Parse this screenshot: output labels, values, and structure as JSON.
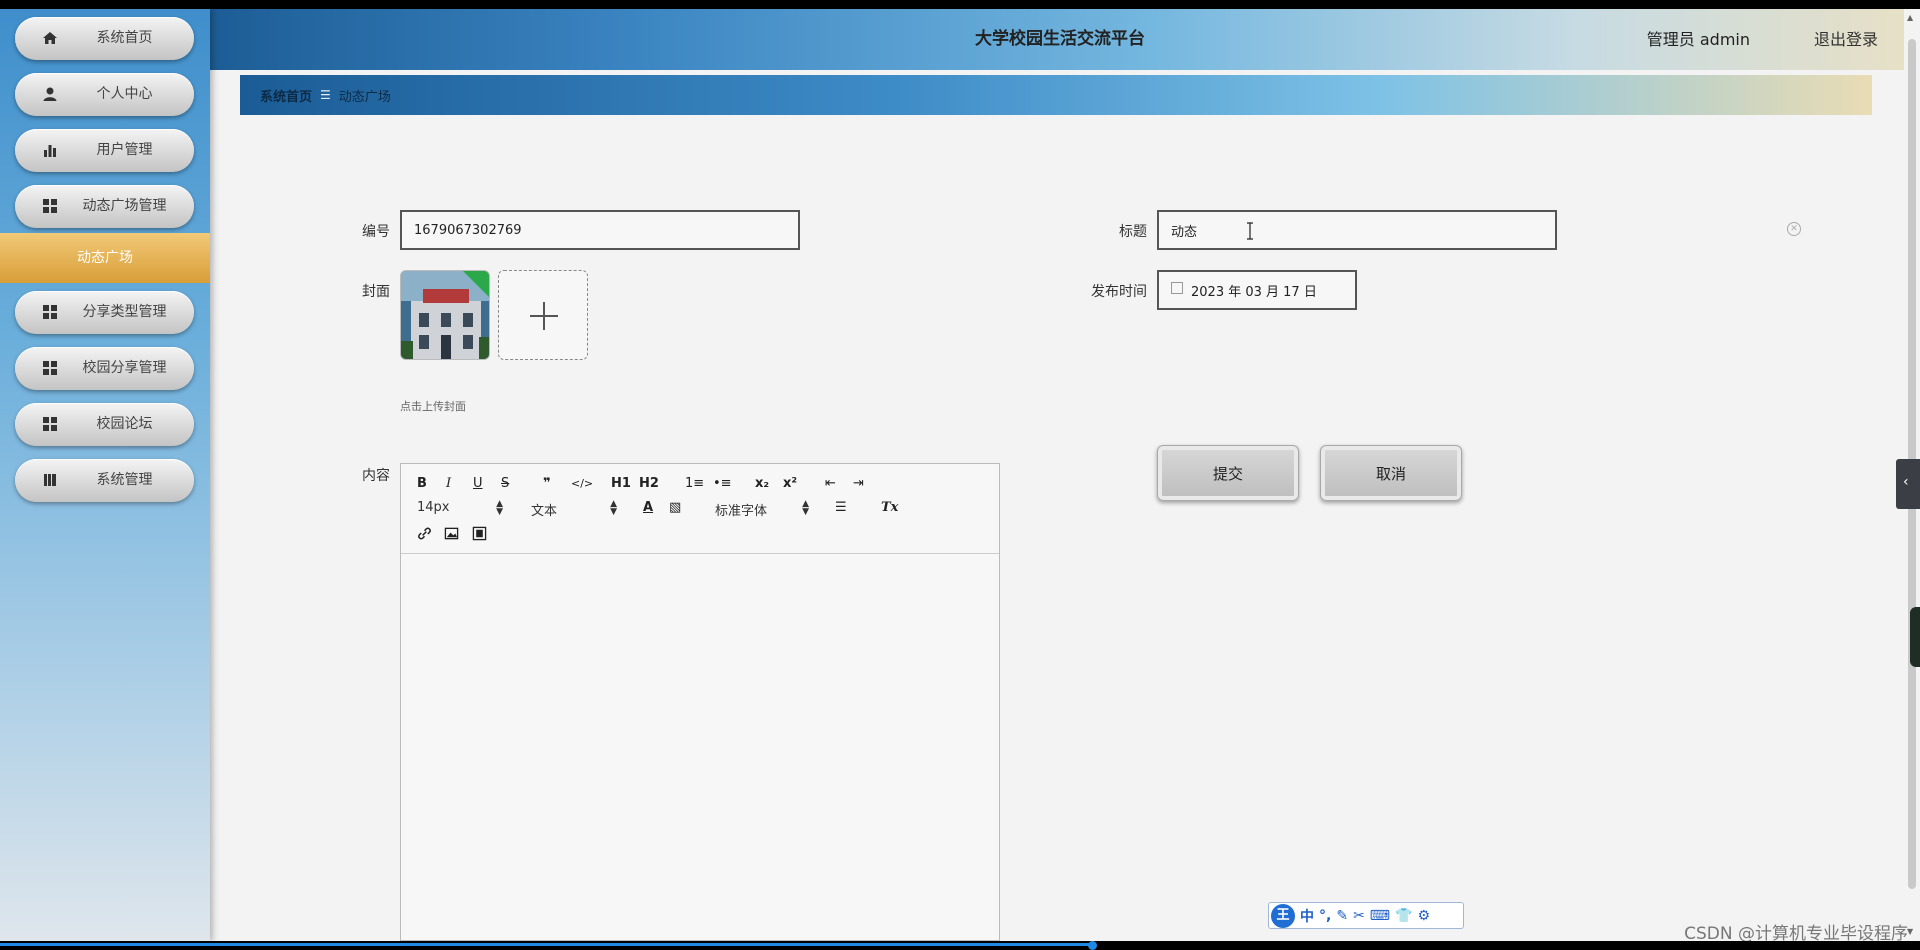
{
  "header": {
    "title": "大学校园生活交流平台",
    "user": "管理员 admin",
    "logout": "退出登录"
  },
  "sidebar": {
    "items": [
      {
        "label": "系统首页",
        "icon": "home-icon"
      },
      {
        "label": "个人中心",
        "icon": "person-icon"
      },
      {
        "label": "用户管理",
        "icon": "bar-chart-icon"
      },
      {
        "label": "动态广场管理",
        "icon": "grid-icon"
      },
      {
        "label": "分享类型管理",
        "icon": "grid-icon"
      },
      {
        "label": "校园分享管理",
        "icon": "grid-icon"
      },
      {
        "label": "校园论坛",
        "icon": "grid-icon"
      },
      {
        "label": "系统管理",
        "icon": "book-icon"
      }
    ],
    "active_sub": "动态广场"
  },
  "breadcrumb": {
    "home": "系统首页",
    "separator": "☰",
    "current": "动态广场"
  },
  "form": {
    "number_label": "编号",
    "number_value": "1679067302769",
    "title_label": "标题",
    "title_value": "动态",
    "cover_label": "封面",
    "cover_hint": "点击上传封面",
    "publish_label": "发布时间",
    "publish_value": "2023 年 03 月 17 日",
    "content_label": "内容",
    "submit": "提交",
    "cancel": "取消"
  },
  "editor": {
    "font_size": "14px",
    "block_type": "文本",
    "font_family": "标准字体",
    "row1": [
      "B",
      "I",
      "U",
      "S",
      "❞",
      "</>",
      "H1",
      "H2",
      "1≡",
      "•≡",
      "x₂",
      "x²",
      "⇤",
      "⇥"
    ],
    "color_btn": "A",
    "clear_format": "Tx"
  },
  "ime": {
    "logo": "王",
    "icons": [
      "中",
      "°,",
      "✎",
      "✂",
      "⌨",
      "👕",
      "⚙"
    ]
  },
  "watermark": "CSDN @计算机专业毕设程序",
  "colors": {
    "active_sub_bg": "#d89e39",
    "header_start": "#1d5d96",
    "sidebar_top": "#3f8ecb"
  }
}
